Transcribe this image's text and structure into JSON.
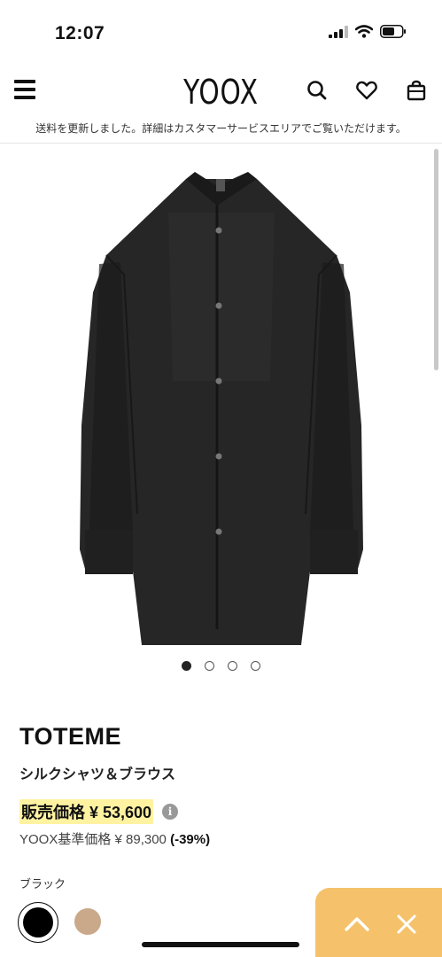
{
  "status": {
    "time": "12:07"
  },
  "header": {
    "logo": "YOOX",
    "menu_icon": "hamburger-icon",
    "search_icon": "search-icon",
    "wishlist_icon": "heart-icon",
    "bag_icon": "bag-icon"
  },
  "notice": "送料を更新しました。詳細はカスタマーサービスエリアでご覧いただけます。",
  "gallery": {
    "image": "product-photo",
    "slide_count": 4,
    "active_slide": 1
  },
  "product": {
    "brand": "TOTEME",
    "name": "シルクシャツ＆ブラウス",
    "sale_price": "販売価格 ¥ 53,600",
    "reference_price": "YOOX基準価格 ¥ 89,300",
    "discount": "(-39%)",
    "color_label": "ブラック",
    "swatches": [
      {
        "name": "black",
        "color": "#000000",
        "selected": true
      },
      {
        "name": "beige",
        "color": "#c9a98a",
        "selected": false
      }
    ]
  },
  "floating_bar": {
    "color": "#f5c26b",
    "up_icon": "chevron-up-icon",
    "close_icon": "close-icon"
  },
  "colors": {
    "highlight": "#fff3a1",
    "accent": "#f5c26b"
  }
}
